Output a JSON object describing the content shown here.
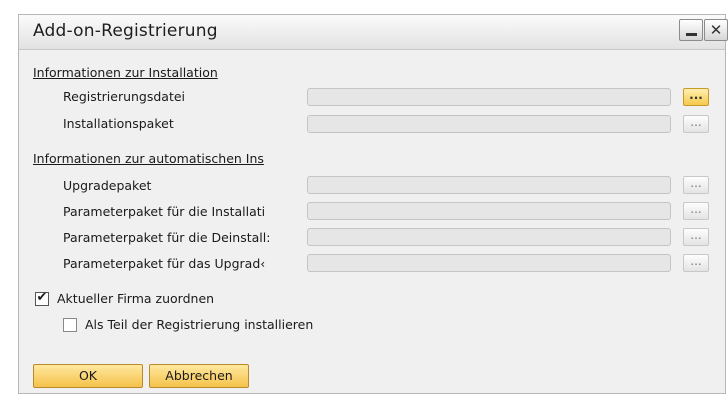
{
  "dialog": {
    "title": "Add-on-Registrierung",
    "minimize_icon": "minimize-icon",
    "close_icon": "close-icon",
    "close_glyph": "✕"
  },
  "installation_section": {
    "heading": "Informationen zur Installation",
    "rows": [
      {
        "label": "Registrierungsdatei",
        "value": "",
        "browse_label": "..."
      },
      {
        "label": "Installationspaket",
        "value": "",
        "browse_label": "..."
      }
    ]
  },
  "automatic_section": {
    "heading": "Informationen zur automatischen Ins",
    "rows": [
      {
        "label": "Upgradepaket",
        "value": "",
        "browse_label": "..."
      },
      {
        "label": "Parameterpaket für die Installati",
        "value": "",
        "browse_label": "..."
      },
      {
        "label": "Parameterpaket für die Deinstall:",
        "value": "",
        "browse_label": "..."
      },
      {
        "label": "Parameterpaket für das Upgrad‹",
        "value": "",
        "browse_label": "..."
      }
    ]
  },
  "options": {
    "assign_company": {
      "label": "Aktueller Firma zuordnen",
      "checked": true
    },
    "install_as_part": {
      "label": "Als Teil der Registrierung installieren",
      "checked": false
    }
  },
  "buttons": {
    "ok": "OK",
    "cancel": "Abbrechen"
  },
  "colors": {
    "accent_button": "#f5c24a",
    "dialog_background": "#f0f0f0"
  }
}
